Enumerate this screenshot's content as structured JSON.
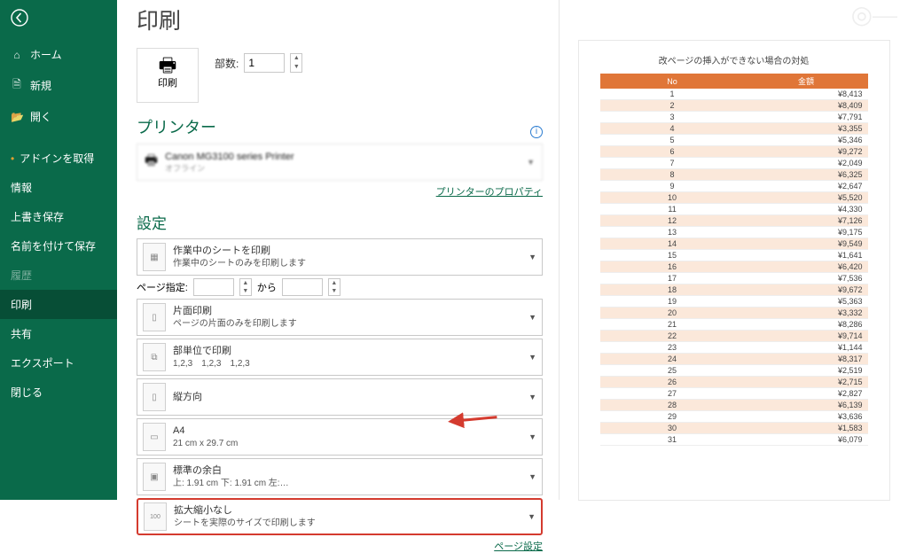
{
  "sidebar": {
    "items": [
      {
        "icon": "⌂",
        "label": "ホーム"
      },
      {
        "icon": "🗎",
        "label": "新規"
      },
      {
        "icon": "📂",
        "label": "開く"
      },
      {
        "icon": "",
        "label": "アドインを取得",
        "dot": true
      },
      {
        "icon": "",
        "label": "情報"
      },
      {
        "icon": "",
        "label": "上書き保存"
      },
      {
        "icon": "",
        "label": "名前を付けて保存"
      },
      {
        "icon": "",
        "label": "履歴",
        "disabled": true
      },
      {
        "icon": "",
        "label": "印刷",
        "active": true
      },
      {
        "icon": "",
        "label": "共有"
      },
      {
        "icon": "",
        "label": "エクスポート"
      },
      {
        "icon": "",
        "label": "閉じる"
      }
    ]
  },
  "title": "印刷",
  "print_btn": "印刷",
  "copies_label": "部数:",
  "copies_value": "1",
  "printer_header": "プリンター",
  "printer_name": "Canon MG3100 series Printer",
  "printer_status": "オフライン",
  "printer_props": "プリンターのプロパティ",
  "settings_header": "設定",
  "opt1": {
    "t1": "作業中のシートを印刷",
    "t2": "作業中のシートのみを印刷します"
  },
  "page_range": {
    "label": "ページ指定:",
    "from": "",
    "to_word": "から",
    "to": ""
  },
  "opt2": {
    "t1": "片面印刷",
    "t2": "ページの片面のみを印刷します"
  },
  "opt3": {
    "t1": "部単位で印刷",
    "t2": "1,2,3　1,2,3　1,2,3"
  },
  "opt4": {
    "t1": "縦方向",
    "t2": ""
  },
  "opt5": {
    "t1": "A4",
    "t2": "21 cm x 29.7 cm"
  },
  "opt6": {
    "t1": "標準の余白",
    "t2": "上: 1.91 cm 下: 1.91 cm 左:…"
  },
  "opt7": {
    "t1": "拡大縮小なし",
    "t2": "シートを実際のサイズで印刷します"
  },
  "page_setup": "ページ設定",
  "preview": {
    "title": "改ページの挿入ができない場合の対処",
    "headers": [
      "No",
      "金額"
    ],
    "rows": [
      [
        "1",
        "¥8,413"
      ],
      [
        "2",
        "¥8,409"
      ],
      [
        "3",
        "¥7,791"
      ],
      [
        "4",
        "¥3,355"
      ],
      [
        "5",
        "¥5,346"
      ],
      [
        "6",
        "¥9,272"
      ],
      [
        "7",
        "¥2,049"
      ],
      [
        "8",
        "¥6,325"
      ],
      [
        "9",
        "¥2,647"
      ],
      [
        "10",
        "¥5,520"
      ],
      [
        "11",
        "¥4,330"
      ],
      [
        "12",
        "¥7,126"
      ],
      [
        "13",
        "¥9,175"
      ],
      [
        "14",
        "¥9,549"
      ],
      [
        "15",
        "¥1,641"
      ],
      [
        "16",
        "¥6,420"
      ],
      [
        "17",
        "¥7,536"
      ],
      [
        "18",
        "¥9,672"
      ],
      [
        "19",
        "¥5,363"
      ],
      [
        "20",
        "¥3,332"
      ],
      [
        "21",
        "¥8,286"
      ],
      [
        "22",
        "¥9,714"
      ],
      [
        "23",
        "¥1,144"
      ],
      [
        "24",
        "¥8,317"
      ],
      [
        "25",
        "¥2,519"
      ],
      [
        "26",
        "¥2,715"
      ],
      [
        "27",
        "¥2,827"
      ],
      [
        "28",
        "¥6,139"
      ],
      [
        "29",
        "¥3,636"
      ],
      [
        "30",
        "¥1,583"
      ],
      [
        "31",
        "¥6,079"
      ]
    ]
  }
}
